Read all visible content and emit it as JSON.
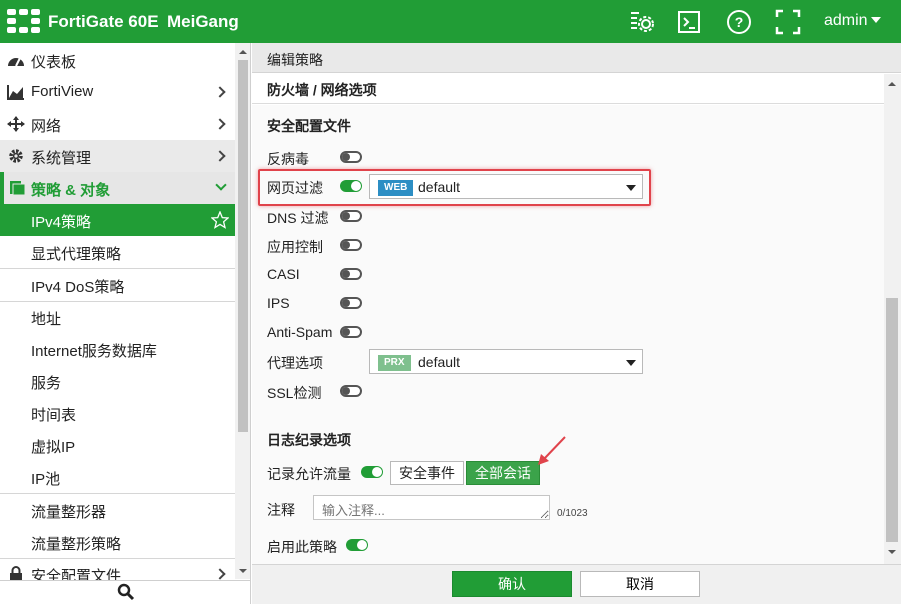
{
  "header": {
    "brand": "FortiGate 60E",
    "hostname": "MeiGang",
    "user": "admin",
    "icons": [
      "settings-console-icon",
      "cli-icon",
      "help-icon",
      "fullscreen-icon"
    ]
  },
  "sidebar": {
    "items": [
      {
        "label": "仪表板",
        "icon": "dashboard-icon"
      },
      {
        "label": "FortiView",
        "icon": "chart-icon"
      },
      {
        "label": "网络",
        "icon": "network-icon"
      },
      {
        "label": "系统管理",
        "icon": "gear-icon"
      },
      {
        "label": "策略 & 对象",
        "icon": "policy-icon"
      },
      {
        "label": "IPv4策略"
      },
      {
        "label": "显式代理策略"
      },
      {
        "label": "IPv4 DoS策略"
      },
      {
        "label": "地址"
      },
      {
        "label": "Internet服务数据库"
      },
      {
        "label": "服务"
      },
      {
        "label": "时间表"
      },
      {
        "label": "虚拟IP"
      },
      {
        "label": "IP池"
      },
      {
        "label": "流量整形器"
      },
      {
        "label": "流量整形策略"
      },
      {
        "label": "安全配置文件",
        "icon": "lock-icon"
      }
    ]
  },
  "main": {
    "breadcrumb": "编辑策略",
    "section_header": "防火墙 / 网络选项",
    "security_profiles": {
      "title": "安全配置文件",
      "antivirus": {
        "label": "反病毒",
        "enabled": false
      },
      "web_filter": {
        "label": "网页过滤",
        "enabled": true,
        "tag": "WEB",
        "value": "default"
      },
      "dns_filter": {
        "label": "DNS 过滤",
        "enabled": false
      },
      "app_control": {
        "label": "应用控制",
        "enabled": false
      },
      "casi": {
        "label": "CASI",
        "enabled": false
      },
      "ips": {
        "label": "IPS",
        "enabled": false
      },
      "antispam": {
        "label": "Anti-Spam",
        "enabled": false
      },
      "proxy_options": {
        "label": "代理选项",
        "tag": "PRX",
        "value": "default"
      },
      "ssl_inspection": {
        "label": "SSL检测",
        "enabled": false
      }
    },
    "logging": {
      "title": "日志纪录选项",
      "log_allowed_label": "记录允许流量",
      "log_allowed_enabled": true,
      "option_security_events": "安全事件",
      "option_all_sessions": "全部会话",
      "selected": "全部会话"
    },
    "comment": {
      "label": "注释",
      "placeholder": "输入注释...",
      "counter": "0/1023"
    },
    "enable_policy": {
      "label": "启用此策略",
      "enabled": true
    },
    "buttons": {
      "ok": "确认",
      "cancel": "取消"
    }
  },
  "colors": {
    "brand_green": "#219d36",
    "highlight_red": "#e0434b",
    "web_tag": "#2c8ec4",
    "prx_tag": "#7fc08e"
  }
}
